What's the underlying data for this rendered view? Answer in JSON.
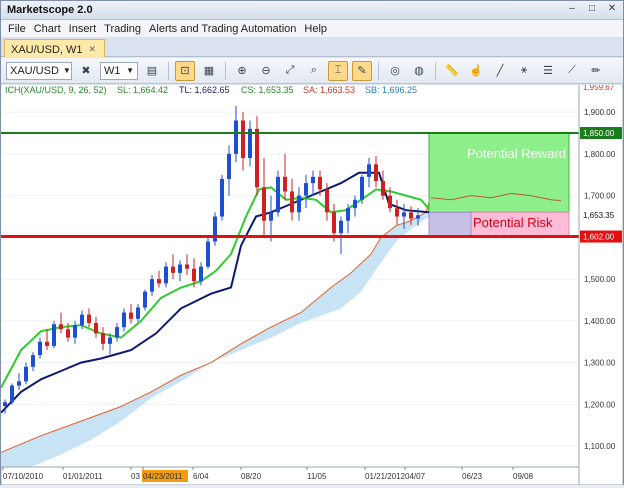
{
  "app": {
    "title": "Marketscope 2.0"
  },
  "window_controls": [
    "–",
    "□",
    "✕"
  ],
  "menu": [
    "File",
    "Chart",
    "Insert",
    "Trading",
    "Alerts and Trading Automation",
    "Help"
  ],
  "mdi_controls": [
    "–",
    "□",
    "✕"
  ],
  "tab": {
    "label": "XAU/USD, W1",
    "close": "✕"
  },
  "toolbar": {
    "symbol": "XAU/USD",
    "timeframe": "W1"
  },
  "indicator_legend": {
    "name": "ICH(XAU/USD, 9, 26, 52)",
    "sl": "SL: 1,664.42",
    "tl": "TL: 1,662.65",
    "cs": "CS: 1,653.35",
    "sa": "SA: 1,663.53",
    "sb": "SB: 1,696.25"
  },
  "annotations": {
    "reward": "Potential Reward",
    "risk": "Potential Risk"
  },
  "price_tags": {
    "upper": "1,850.00",
    "current": "1,653.35",
    "lower": "1,602.00",
    "top": "1,959.67"
  },
  "colors": {
    "bull": "#1f4fd1",
    "bear": "#d02020",
    "cloud": "#c8e3f3",
    "green_line": "#2ecc2e",
    "navy_line": "#0b1a6e",
    "reward": "#8ef08a",
    "risk": "#ffbcd6"
  },
  "chart_data": {
    "type": "candlestick",
    "ylim": [
      1050,
      1965
    ],
    "yticks": [
      "1,900.00",
      "1,800.00",
      "1,700.00",
      "1,600.00",
      "1,500.00",
      "1,400.00",
      "1,300.00",
      "1,200.00",
      "1,100.00"
    ],
    "xticks": [
      "07/10/2010",
      "01/01/2011",
      "03",
      "04/23/2011",
      "6/04",
      "08/20",
      "11/05",
      "01/21/2012",
      "04/07",
      "06/23",
      "09/08"
    ],
    "horizontal_lines": [
      1850,
      1602
    ],
    "current_price": 1653.35
  }
}
